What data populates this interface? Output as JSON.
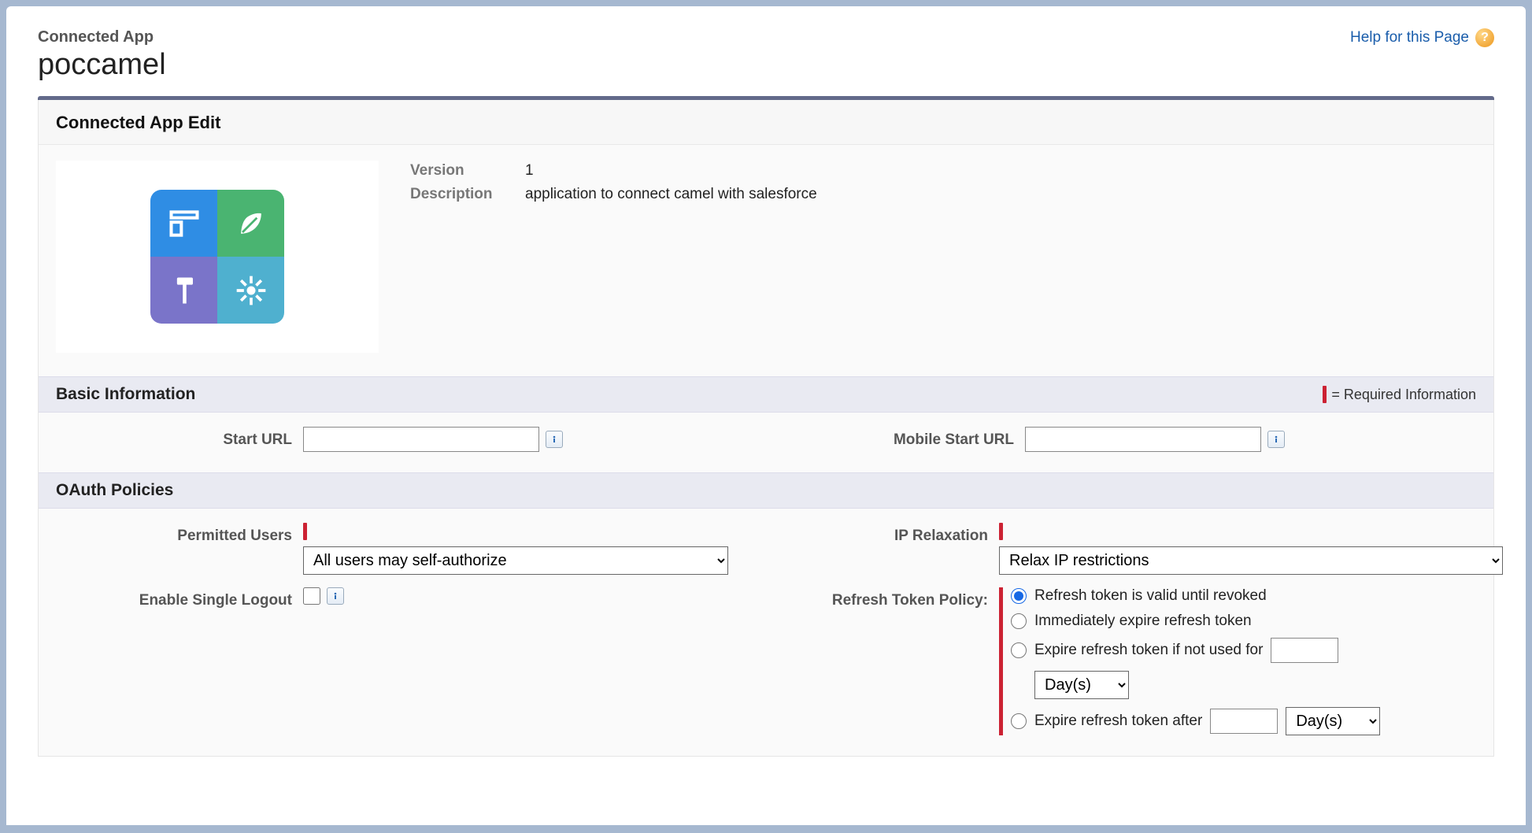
{
  "header": {
    "breadcrumb": "Connected App",
    "title": "poccamel",
    "help_label": "Help for this Page"
  },
  "panel": {
    "title": "Connected App Edit",
    "version_label": "Version",
    "version_value": "1",
    "description_label": "Description",
    "description_value": "application to connect camel with salesforce"
  },
  "basic": {
    "section_title": "Basic Information",
    "required_hint": "= Required Information",
    "start_url_label": "Start URL",
    "start_url_value": "",
    "mobile_start_url_label": "Mobile Start URL",
    "mobile_start_url_value": ""
  },
  "oauth": {
    "section_title": "OAuth Policies",
    "permitted_users_label": "Permitted Users",
    "permitted_users_value": "All users may self-authorize",
    "ip_relaxation_label": "IP Relaxation",
    "ip_relaxation_value": "Relax IP restrictions",
    "enable_single_logout_label": "Enable Single Logout",
    "enable_single_logout_checked": false,
    "refresh_token_policy_label": "Refresh Token Policy:",
    "refresh_options": {
      "valid_until_revoked": "Refresh token is valid until revoked",
      "immediately_expire": "Immediately expire refresh token",
      "expire_if_not_used_for": "Expire refresh token if not used for",
      "expire_after": "Expire refresh token after"
    },
    "refresh_not_used_value": "",
    "refresh_not_used_unit": "Day(s)",
    "refresh_after_value": "",
    "refresh_after_unit": "Day(s)",
    "refresh_selected": "valid_until_revoked"
  }
}
